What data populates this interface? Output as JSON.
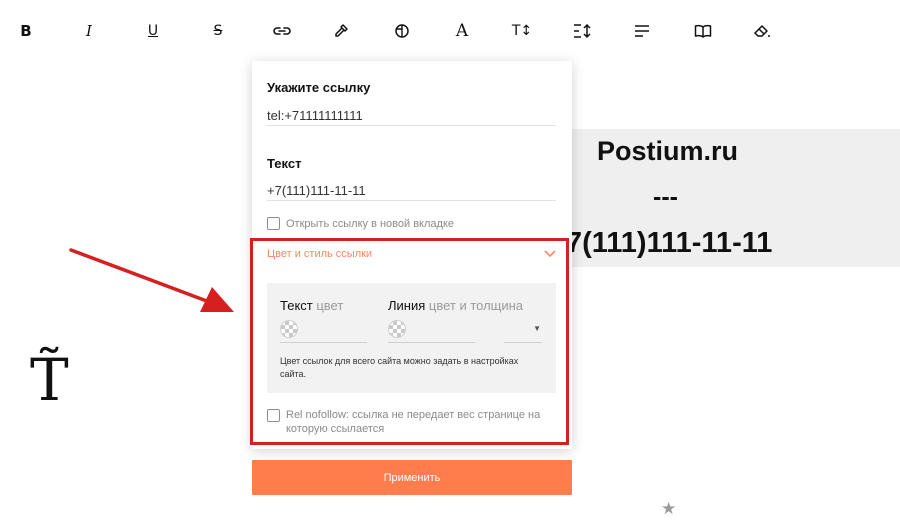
{
  "toolbar": {
    "bold_label": "B",
    "italic_label": "I",
    "underline_label": "U",
    "strike_label": "S",
    "text_style_label": "A",
    "text_size_label": "T↕",
    "icons": [
      "bold-icon",
      "italic-icon",
      "underline-icon",
      "strikethrough-icon",
      "link-icon",
      "eyedropper-icon",
      "globe-icon",
      "text-style-icon",
      "text-size-icon",
      "line-height-icon",
      "align-icon",
      "book-icon",
      "eraser-icon"
    ]
  },
  "content": {
    "line1": "Postium.ru",
    "line2": "---",
    "line3": "+7(111)111-11-11"
  },
  "logo": {
    "glyph": "T̃"
  },
  "link_dialog": {
    "url_label": "Укажите ссылку",
    "url_value": "tel:+71111111111",
    "text_label": "Текст",
    "text_value": "+7(111)111-11-11",
    "new_tab_label": "Открыть ссылку в новой вкладке",
    "new_tab_checked": false,
    "style_section_title": "Цвет и стиль ссылки",
    "style_section_expanded": true,
    "text_color_label": "Текст",
    "text_color_muted": " цвет",
    "line_label": "Линия",
    "line_muted": " цвет и толщина",
    "select_arrow": "▼",
    "site_note": "Цвет ссылок для всего сайта можно задать в настройках сайта.",
    "nofollow_label": "Rel nofollow: ссылка не передает вес странице на которую ссылается",
    "nofollow_checked": false,
    "apply_label": "Применить"
  },
  "footer": {
    "star": "★"
  },
  "colors": {
    "accent": "#ff7c4c",
    "accordion_text": "#ff8562",
    "annotation_red": "#d61f1f",
    "panel_bg": "#f2f2f2",
    "content_bg": "#efefef"
  }
}
